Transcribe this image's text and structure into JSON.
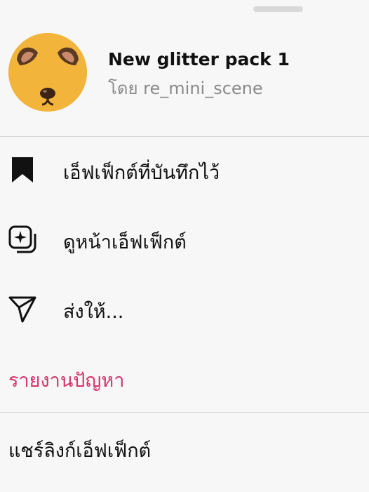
{
  "sheet": {
    "effect": {
      "title": "New glitter pack 1",
      "byline": "โดย re_mini_scene"
    },
    "menu": [
      {
        "label": "เอ็ฟเฟ็กต์ที่บันทึกไว้",
        "icon": "bookmark-icon"
      },
      {
        "label": "ดูหน้าเอ็ฟเฟ็กต์",
        "icon": "effects-page-icon"
      },
      {
        "label": "ส่งให้...",
        "icon": "send-icon"
      }
    ],
    "report_label": "รายงานปัญหา",
    "share_link_label": "แชร์ลิงก์เอ็ฟเฟ็กต์"
  },
  "colors": {
    "report": "#d6336c",
    "avatar": "#f2b43a"
  }
}
